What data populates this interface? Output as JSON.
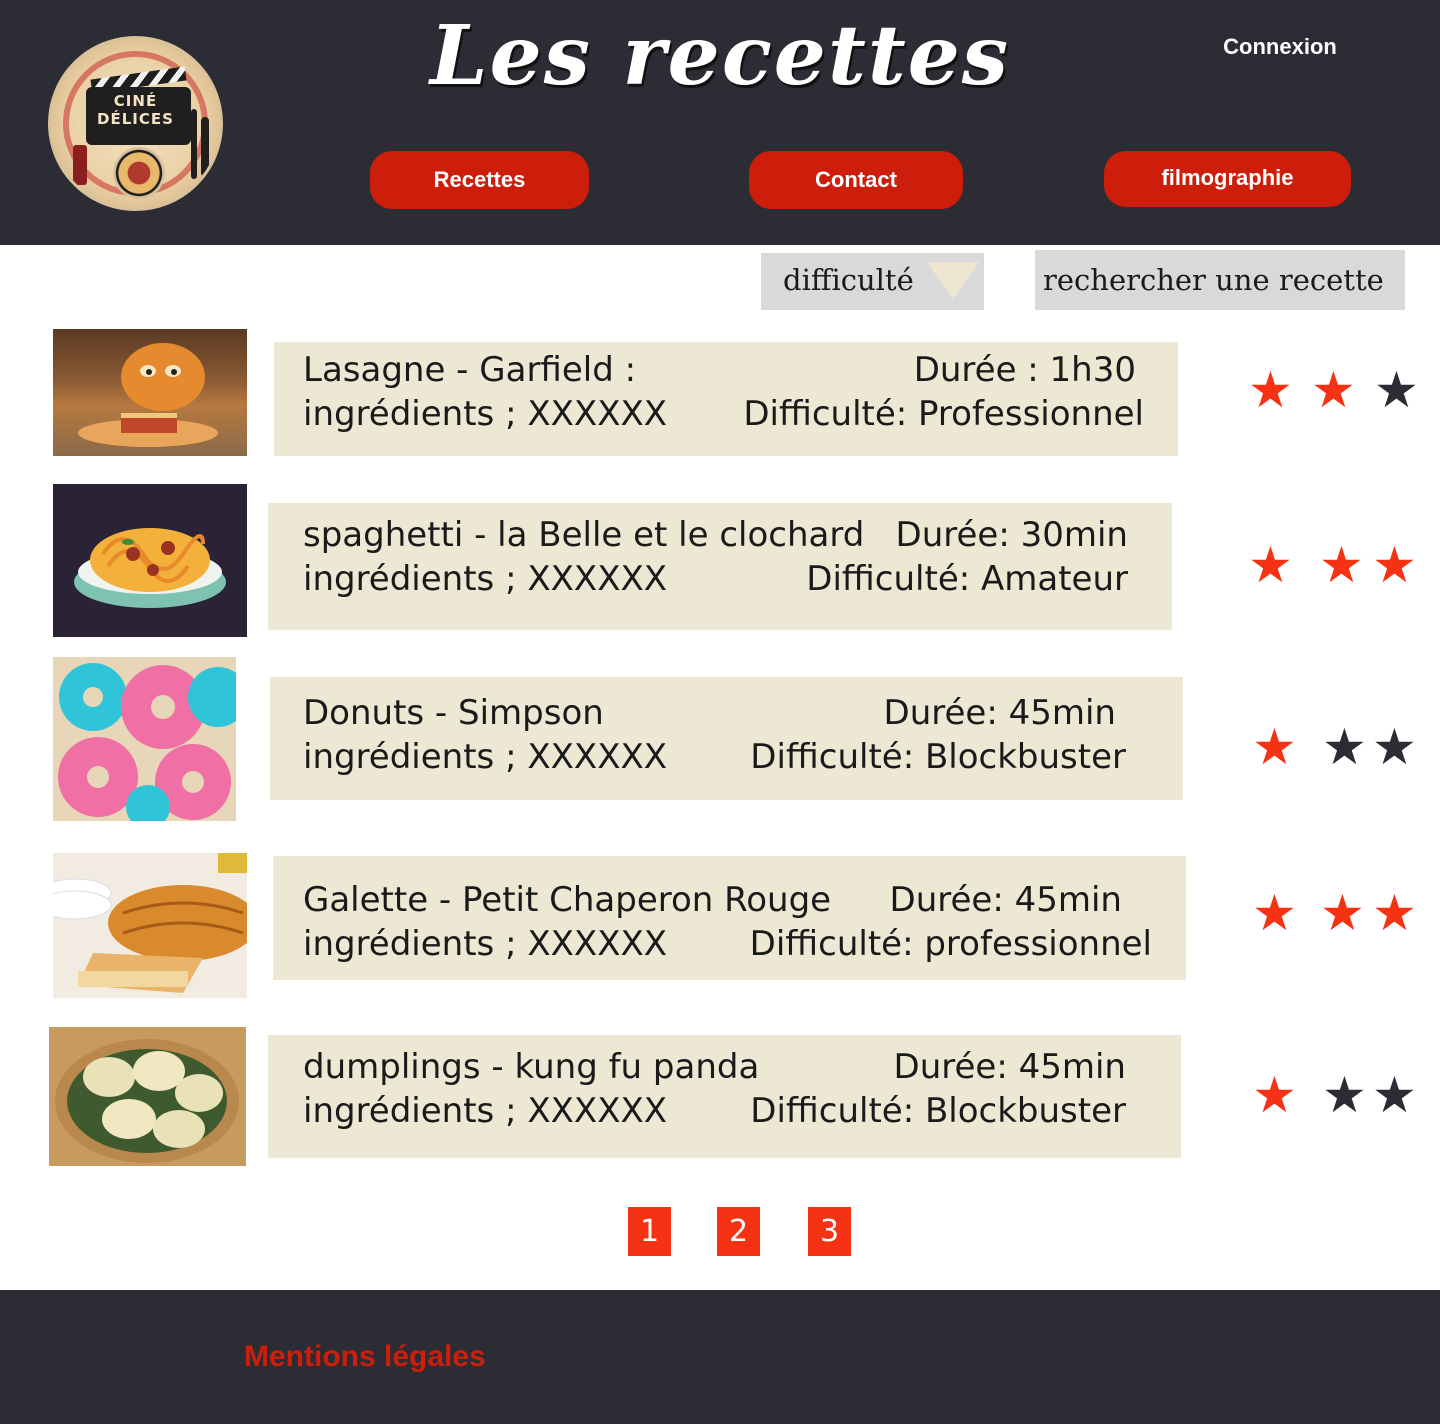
{
  "header": {
    "title": "Les recettes",
    "connexion_label": "Connexion",
    "logo": {
      "line1": "CINÉ",
      "line2": "DÉLICES"
    },
    "nav": {
      "recettes": "Recettes",
      "contact": "Contact",
      "filmographie": "filmographie"
    }
  },
  "filters": {
    "difficulty_label": "difficulté",
    "search_placeholder": "rechercher une recette"
  },
  "recipes": [
    {
      "title": "Lasagne - Garfield :",
      "ingredients": "ingrédients ; XXXXXX",
      "duration": "Durée : 1h30",
      "difficulty": "Difficulté: Professionnel",
      "rating": 2,
      "image": "lasagne-garfield-image"
    },
    {
      "title": "spaghetti - la Belle et le clochard",
      "ingredients": "ingrédients ; XXXXXX",
      "duration": "Durée: 30min",
      "difficulty": "Difficulté: Amateur",
      "rating": 3,
      "image": "spaghetti-image"
    },
    {
      "title": "Donuts - Simpson",
      "ingredients": "ingrédients ; XXXXXX",
      "duration": "Durée: 45min",
      "difficulty": "Difficulté: Blockbuster",
      "rating": 1,
      "image": "donuts-image"
    },
    {
      "title": "Galette - Petit Chaperon Rouge",
      "ingredients": "ingrédients ; XXXXXX",
      "duration": "Durée: 45min",
      "difficulty": "Difficulté: professionnel",
      "rating": 3,
      "image": "galette-image"
    },
    {
      "title": "dumplings - kung fu panda",
      "ingredients": "ingrédients ; XXXXXX",
      "duration": "Durée: 45min",
      "difficulty": "Difficulté: Blockbuster",
      "rating": 1,
      "image": "dumplings-image"
    }
  ],
  "pagination": [
    "1",
    "2",
    "3"
  ],
  "footer": {
    "mentions": "Mentions légales"
  },
  "colors": {
    "header_bg": "#2b2c34",
    "accent_red": "#cc1e0b",
    "star_on": "#f53314",
    "star_off": "#2b2c34",
    "card_bg": "#ede8d4"
  }
}
